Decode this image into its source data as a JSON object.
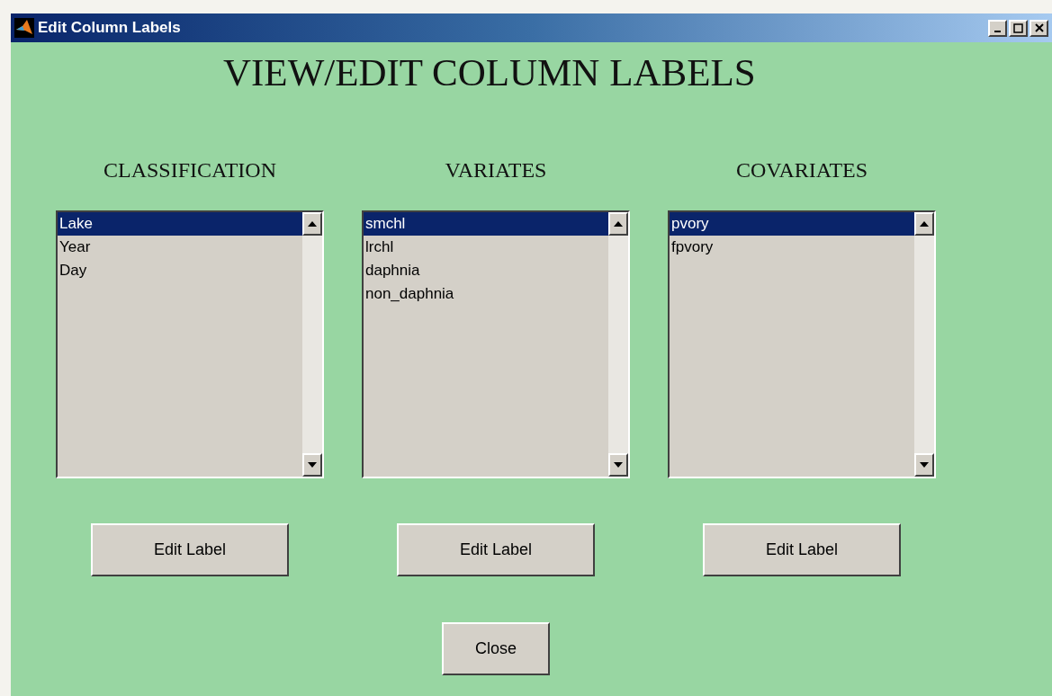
{
  "window": {
    "title": "Edit Column Labels"
  },
  "heading": "VIEW/EDIT COLUMN LABELS",
  "panels": [
    {
      "title": "CLASSIFICATION",
      "items": [
        {
          "label": "Lake",
          "selected": true
        },
        {
          "label": "Year",
          "selected": false
        },
        {
          "label": "Day",
          "selected": false
        }
      ],
      "button": "Edit Label"
    },
    {
      "title": "VARIATES",
      "items": [
        {
          "label": "smchl",
          "selected": true
        },
        {
          "label": "lrchl",
          "selected": false
        },
        {
          "label": "daphnia",
          "selected": false
        },
        {
          "label": "non_daphnia",
          "selected": false
        }
      ],
      "button": "Edit Label"
    },
    {
      "title": "COVARIATES",
      "items": [
        {
          "label": "pvory",
          "selected": true
        },
        {
          "label": "fpvory",
          "selected": false
        }
      ],
      "button": "Edit Label"
    }
  ],
  "close_button": "Close"
}
